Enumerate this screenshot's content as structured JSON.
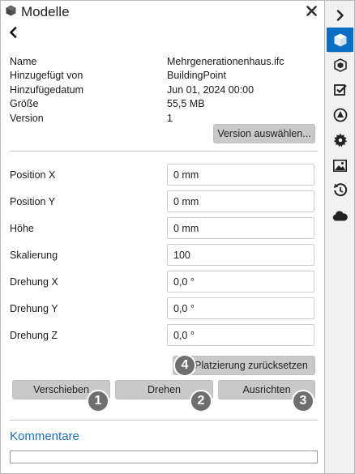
{
  "header": {
    "title": "Modelle",
    "close_label": "×"
  },
  "info": [
    {
      "label": "Name",
      "value": "Mehrgenerationenhaus.ifc"
    },
    {
      "label": "Hinzugefügt von",
      "value": "BuildingPoint"
    },
    {
      "label": "Hinzufügedatum",
      "value": "Jun 01, 2024 00:00"
    },
    {
      "label": "Größe",
      "value": "55,5 MB"
    },
    {
      "label": "Version",
      "value": "1"
    }
  ],
  "version_button": "Version auswählen...",
  "fields": [
    {
      "label": "Position X",
      "value": "0 mm"
    },
    {
      "label": "Position Y",
      "value": "0 mm"
    },
    {
      "label": "Höhe",
      "value": "0 mm"
    },
    {
      "label": "Skalierung",
      "value": "100"
    },
    {
      "label": "Drehung X",
      "value": "0,0 °"
    },
    {
      "label": "Drehung Y",
      "value": "0,0 °"
    },
    {
      "label": "Drehung Z",
      "value": "0,0 °"
    }
  ],
  "reset_button": "Platzierung zurücksetzen",
  "actions": {
    "move": "Verschieben",
    "rotate": "Drehen",
    "align": "Ausrichten"
  },
  "badges": {
    "move": "1",
    "rotate": "2",
    "align": "3",
    "reset": "4"
  },
  "comments": {
    "title": "Kommentare"
  },
  "rail": {
    "items": [
      "expand-chevron-icon",
      "cube-icon",
      "model-box-icon",
      "checklist-icon",
      "shapes-icon",
      "gear-icon",
      "image-icon",
      "history-icon",
      "cloud-icon"
    ],
    "active_color": "#0a6fc2"
  },
  "colors": {
    "accent": "#1e6bb8",
    "button": "#c9c9c9",
    "badge": "#6e6e6e"
  }
}
